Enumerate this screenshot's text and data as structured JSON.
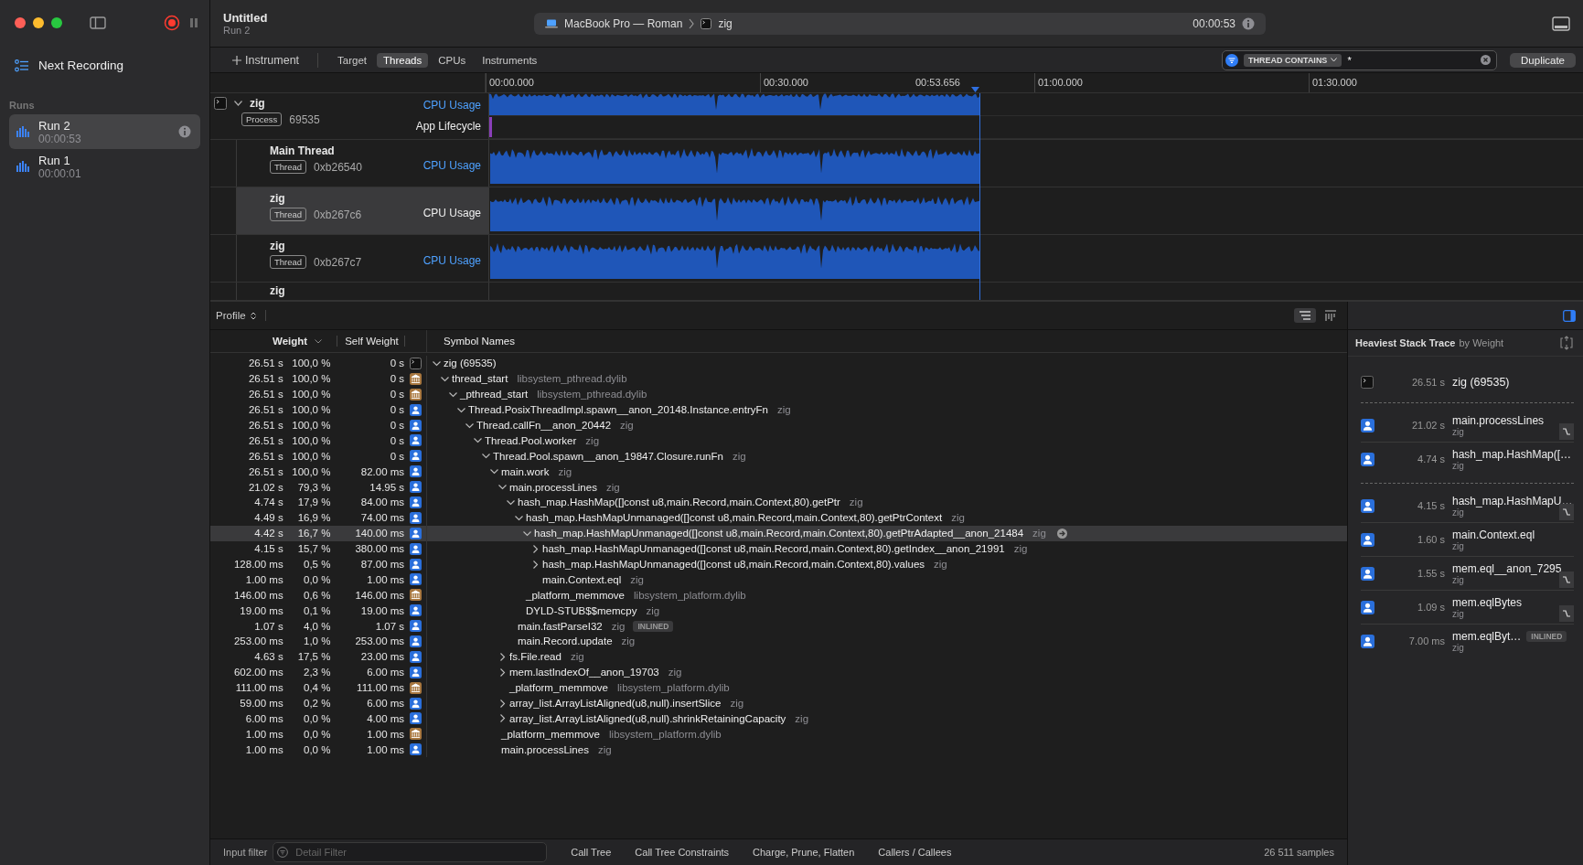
{
  "sidebar": {
    "next_recording": "Next Recording",
    "runs_label": "Runs",
    "runs": [
      {
        "name": "Run 2",
        "duration": "00:00:53",
        "selected": true
      },
      {
        "name": "Run 1",
        "duration": "00:00:01",
        "selected": false
      }
    ]
  },
  "toolbar": {
    "title": "Untitled",
    "subtitle": "Run 2",
    "device": "MacBook Pro — Roman",
    "target": "zig",
    "elapsed": "00:00:53"
  },
  "instrument_bar": {
    "add_instrument": "Instrument",
    "tabs": [
      {
        "label": "Target",
        "selected": false
      },
      {
        "label": "Threads",
        "selected": true
      },
      {
        "label": "CPUs",
        "selected": false
      },
      {
        "label": "Instruments",
        "selected": false
      }
    ],
    "filter_token": "THREAD CONTAINS",
    "filter_value": "*",
    "duplicate": "Duplicate"
  },
  "timeline": {
    "ticks": [
      "00:00.000",
      "00:30.000",
      "01:00.000",
      "01:30.000"
    ],
    "playhead": "00:53.656"
  },
  "process_track": {
    "name": "zig",
    "expanded": true,
    "badge": "Process",
    "pid": "69535",
    "lanes": [
      {
        "kind": "cpu",
        "label": "CPU Usage"
      },
      {
        "kind": "lifecycle",
        "label": "App Lifecycle"
      }
    ]
  },
  "thread_tracks": [
    {
      "name": "Main Thread",
      "badge": "Thread",
      "tid": "0xb26540",
      "lane": "CPU Usage",
      "selected": false
    },
    {
      "name": "zig",
      "badge": "Thread",
      "tid": "0xb267c6",
      "lane": "CPU Usage",
      "selected": true
    },
    {
      "name": "zig",
      "badge": "Thread",
      "tid": "0xb267c7",
      "lane": "CPU Usage",
      "selected": false
    },
    {
      "name": "zig",
      "selected": false
    }
  ],
  "profile": {
    "mode": "Profile",
    "columns": {
      "weight": "Weight",
      "self_weight": "Self Weight",
      "symbol": "Symbol Names"
    },
    "call_tree": [
      {
        "weight": "26.51 s",
        "percent": "100,0 %",
        "self": "0 s",
        "kind": "terminal",
        "symbol": "zig (69535)",
        "expanded": true,
        "selected": false,
        "children": [
          {
            "weight": "26.51 s",
            "percent": "100,0 %",
            "self": "0 s",
            "kind": "library",
            "symbol": "thread_start",
            "library": "libsystem_pthread.dylib",
            "expanded": true,
            "selected": false,
            "children": [
              {
                "weight": "26.51 s",
                "percent": "100,0 %",
                "self": "0 s",
                "kind": "library",
                "symbol": "_pthread_start",
                "library": "libsystem_pthread.dylib",
                "expanded": true,
                "selected": false,
                "children": [
                  {
                    "weight": "26.51 s",
                    "percent": "100,0 %",
                    "self": "0 s",
                    "kind": "user",
                    "symbol": "Thread.PosixThreadImpl.spawn__anon_20148.Instance.entryFn",
                    "library": "zig",
                    "expanded": true,
                    "selected": false,
                    "children": [
                      {
                        "weight": "26.51 s",
                        "percent": "100,0 %",
                        "self": "0 s",
                        "kind": "user",
                        "symbol": "Thread.callFn__anon_20442",
                        "library": "zig",
                        "expanded": true,
                        "selected": false,
                        "children": [
                          {
                            "weight": "26.51 s",
                            "percent": "100,0 %",
                            "self": "0 s",
                            "kind": "user",
                            "symbol": "Thread.Pool.worker",
                            "library": "zig",
                            "expanded": true,
                            "selected": false,
                            "children": [
                              {
                                "weight": "26.51 s",
                                "percent": "100,0 %",
                                "self": "0 s",
                                "kind": "user",
                                "symbol": "Thread.Pool.spawn__anon_19847.Closure.runFn",
                                "library": "zig",
                                "expanded": true,
                                "selected": false,
                                "children": [
                                  {
                                    "weight": "26.51 s",
                                    "percent": "100,0 %",
                                    "self": "82.00 ms",
                                    "kind": "user",
                                    "symbol": "main.work",
                                    "library": "zig",
                                    "expanded": true,
                                    "selected": false,
                                    "children": [
                                      {
                                        "weight": "21.02 s",
                                        "percent": "79,3 %",
                                        "self": "14.95 s",
                                        "kind": "user",
                                        "symbol": "main.processLines",
                                        "library": "zig",
                                        "expanded": true,
                                        "selected": false,
                                        "children": [
                                          {
                                            "weight": "4.74 s",
                                            "percent": "17,9 %",
                                            "self": "84.00 ms",
                                            "kind": "user",
                                            "symbol": "hash_map.HashMap([]const u8,main.Record,main.Context,80).getPtr",
                                            "library": "zig",
                                            "expanded": true,
                                            "selected": false,
                                            "children": [
                                              {
                                                "weight": "4.49 s",
                                                "percent": "16,9 %",
                                                "self": "74.00 ms",
                                                "kind": "user",
                                                "symbol": "hash_map.HashMapUnmanaged([]const u8,main.Record,main.Context,80).getPtrContext",
                                                "library": "zig",
                                                "expanded": true,
                                                "selected": false,
                                                "children": [
                                                  {
                                                    "weight": "4.42 s",
                                                    "percent": "16,7 %",
                                                    "self": "140.00 ms",
                                                    "kind": "user",
                                                    "symbol": "hash_map.HashMapUnmanaged([]const u8,main.Record,main.Context,80).getPtrAdapted__anon_21484",
                                                    "library": "zig",
                                                    "expanded": true,
                                                    "selected": true,
                                                    "children": [
                                                      {
                                                        "weight": "4.15 s",
                                                        "percent": "15,7 %",
                                                        "self": "380.00 ms",
                                                        "kind": "user",
                                                        "symbol": "hash_map.HashMapUnmanaged([]const u8,main.Record,main.Context,80).getIndex__anon_21991",
                                                        "library": "zig",
                                                        "expanded": false,
                                                        "selected": false
                                                      },
                                                      {
                                                        "weight": "128.00 ms",
                                                        "percent": "0,5 %",
                                                        "self": "87.00 ms",
                                                        "kind": "user",
                                                        "symbol": "hash_map.HashMapUnmanaged([]const u8,main.Record,main.Context,80).values",
                                                        "library": "zig",
                                                        "expanded": false,
                                                        "selected": false
                                                      },
                                                      {
                                                        "weight": "1.00 ms",
                                                        "percent": "0,0 %",
                                                        "self": "1.00 ms",
                                                        "kind": "user",
                                                        "symbol": "main.Context.eql",
                                                        "library": "zig",
                                                        "selected": false
                                                      }
                                                    ]
                                                  }
                                                ]
                                              },
                                              {
                                                "weight": "146.00 ms",
                                                "percent": "0,6 %",
                                                "self": "146.00 ms",
                                                "kind": "library",
                                                "symbol": "_platform_memmove",
                                                "library": "libsystem_platform.dylib",
                                                "selected": false
                                              },
                                              {
                                                "weight": "19.00 ms",
                                                "percent": "0,1 %",
                                                "self": "19.00 ms",
                                                "kind": "user",
                                                "symbol": "DYLD-STUB$$memcpy",
                                                "library": "zig",
                                                "selected": false
                                              }
                                            ]
                                          },
                                          {
                                            "weight": "1.07 s",
                                            "percent": "4,0 %",
                                            "self": "1.07 s",
                                            "kind": "user",
                                            "symbol": "main.fastParseI32",
                                            "library": "zig",
                                            "badge": "INLINED",
                                            "selected": false
                                          },
                                          {
                                            "weight": "253.00 ms",
                                            "percent": "1,0 %",
                                            "self": "253.00 ms",
                                            "kind": "user",
                                            "symbol": "main.Record.update",
                                            "library": "zig",
                                            "selected": false
                                          }
                                        ]
                                      },
                                      {
                                        "weight": "4.63 s",
                                        "percent": "17,5 %",
                                        "self": "23.00 ms",
                                        "kind": "user",
                                        "symbol": "fs.File.read",
                                        "library": "zig",
                                        "expanded": false,
                                        "selected": false
                                      },
                                      {
                                        "weight": "602.00 ms",
                                        "percent": "2,3 %",
                                        "self": "6.00 ms",
                                        "kind": "user",
                                        "symbol": "mem.lastIndexOf__anon_19703",
                                        "library": "zig",
                                        "expanded": false,
                                        "selected": false
                                      },
                                      {
                                        "weight": "111.00 ms",
                                        "percent": "0,4 %",
                                        "self": "111.00 ms",
                                        "kind": "library",
                                        "symbol": "_platform_memmove",
                                        "library": "libsystem_platform.dylib",
                                        "selected": false
                                      },
                                      {
                                        "weight": "59.00 ms",
                                        "percent": "0,2 %",
                                        "self": "6.00 ms",
                                        "kind": "user",
                                        "symbol": "array_list.ArrayListAligned(u8,null).insertSlice",
                                        "library": "zig",
                                        "expanded": false,
                                        "selected": false
                                      },
                                      {
                                        "weight": "6.00 ms",
                                        "percent": "0,0 %",
                                        "self": "4.00 ms",
                                        "kind": "user",
                                        "symbol": "array_list.ArrayListAligned(u8,null).shrinkRetainingCapacity",
                                        "library": "zig",
                                        "expanded": false,
                                        "selected": false
                                      }
                                    ]
                                  },
                                  {
                                    "weight": "1.00 ms",
                                    "percent": "0,0 %",
                                    "self": "1.00 ms",
                                    "kind": "library",
                                    "symbol": "_platform_memmove",
                                    "library": "libsystem_platform.dylib",
                                    "selected": false
                                  },
                                  {
                                    "weight": "1.00 ms",
                                    "percent": "0,0 %",
                                    "self": "1.00 ms",
                                    "kind": "user",
                                    "symbol": "main.processLines",
                                    "library": "zig",
                                    "selected": false
                                  }
                                ]
                              }
                            ]
                          }
                        ]
                      }
                    ]
                  }
                ]
              }
            ]
          }
        ]
      }
    ]
  },
  "bottom_bar": {
    "input_filter": "Input filter",
    "detail_placeholder": "Detail Filter",
    "buttons": [
      "Call Tree",
      "Call Tree Constraints",
      "Charge, Prune, Flatten",
      "Callers / Callees"
    ],
    "samples": "26 511 samples"
  },
  "heaviest": {
    "title": "Heaviest Stack Trace",
    "subtitle": "by Weight",
    "groups": [
      [
        {
          "weight": "26.51 s",
          "kind": "terminal",
          "name": "zig (69535)",
          "focus": false
        }
      ],
      [
        {
          "weight": "21.02 s",
          "kind": "user",
          "name": "main.processLines",
          "library": "zig",
          "focus": true
        },
        {
          "weight": "4.74 s",
          "kind": "user",
          "name": "hash_map.HashMap([…",
          "library": "zig",
          "focus": false
        }
      ],
      [
        {
          "weight": "4.15 s",
          "kind": "user",
          "name": "hash_map.HashMapU…",
          "library": "zig",
          "focus": true
        },
        {
          "weight": "1.60 s",
          "kind": "user",
          "name": "main.Context.eql",
          "library": "zig",
          "focus": false
        },
        {
          "weight": "1.55 s",
          "kind": "user",
          "name": "mem.eql__anon_7295",
          "library": "zig",
          "focus": true
        },
        {
          "weight": "1.09 s",
          "kind": "user",
          "name": "mem.eqlBytes",
          "library": "zig",
          "focus": true
        },
        {
          "weight": "7.00 ms",
          "kind": "user",
          "name": "mem.eqlByt…",
          "library": "zig",
          "badge": "INLINED",
          "focus": false
        }
      ]
    ]
  }
}
